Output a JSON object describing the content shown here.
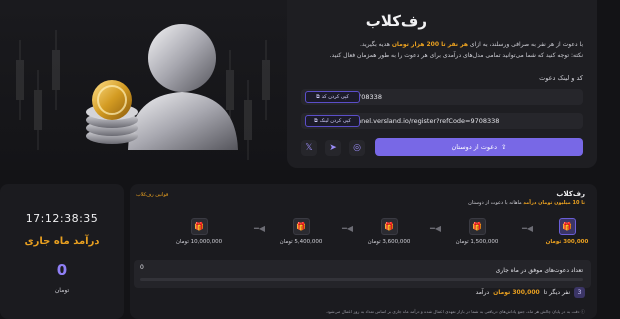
{
  "referral": {
    "title": "رف‌کلاب",
    "desc_line1_prefix": "با دعوت از هر نفر به صرافی ورسلند، به ازای",
    "desc_line1_highlight": "هر نفر تا 200 هزار تومان",
    "desc_line1_suffix": "هدیه بگیرید.",
    "desc_line2": "نکته: توجه کنید که شما می‌توانید تمامی مدل‌های درآمدی برای هر دعوت را به طور همزمان فعال کنید.",
    "code_label": "کد و لینک دعوت",
    "code_value": "9708338",
    "copy_code_label": "کپی کردن کد",
    "link_value": "panel.versland.io/register?refCode=9708338",
    "copy_link_label": "کپی کردن لینک",
    "invite_button_label": "دعوت از دوستان",
    "social": [
      {
        "icon": "x-icon",
        "glyph": "𝕏"
      },
      {
        "icon": "telegram-icon",
        "glyph": "➤"
      },
      {
        "icon": "instagram-icon",
        "glyph": "◎"
      }
    ]
  },
  "stats": {
    "clock": "17:12:38:35",
    "monthly_title": "درآمد ماه جاری",
    "monthly_value": "0",
    "unit": "تومان"
  },
  "levels": {
    "title": "رف‌کلاب",
    "subtitle_prefix": "تا 10 میلیون تومان درآمد",
    "subtitle_suffix": "ماهانه با دعوت از دوستان",
    "rules_link": "قوانین رف‌کلاب",
    "steps": [
      {
        "label": "300,000 تومان",
        "active": true
      },
      {
        "label": "1,500,000 تومان",
        "active": false
      },
      {
        "label": "3,600,000 تومان",
        "active": false
      },
      {
        "label": "5,400,000 تومان",
        "active": false
      },
      {
        "label": "10,000,000 تومان",
        "active": false
      }
    ],
    "progress_label": "تعداد دعوت‌های موفق در ماه جاری",
    "progress_value": "0",
    "progress_fraction": 0,
    "next_badge": "3",
    "next_prefix": "نفر دیگر تا",
    "next_amount": "300,000 تومان",
    "next_suffix": "درآمد",
    "note": "دقت به در پایان چالش هر ماه، جمع پاداش‌های دریافتی به شما در بازار تعهدی اعمال شده و درآمد ماه جاری بر اساس تعداد به روز اعمال می‌شود."
  },
  "colors": {
    "accent": "#7868e6",
    "highlight": "#e9a020",
    "bg": "#131316",
    "card": "#1e1e22"
  }
}
